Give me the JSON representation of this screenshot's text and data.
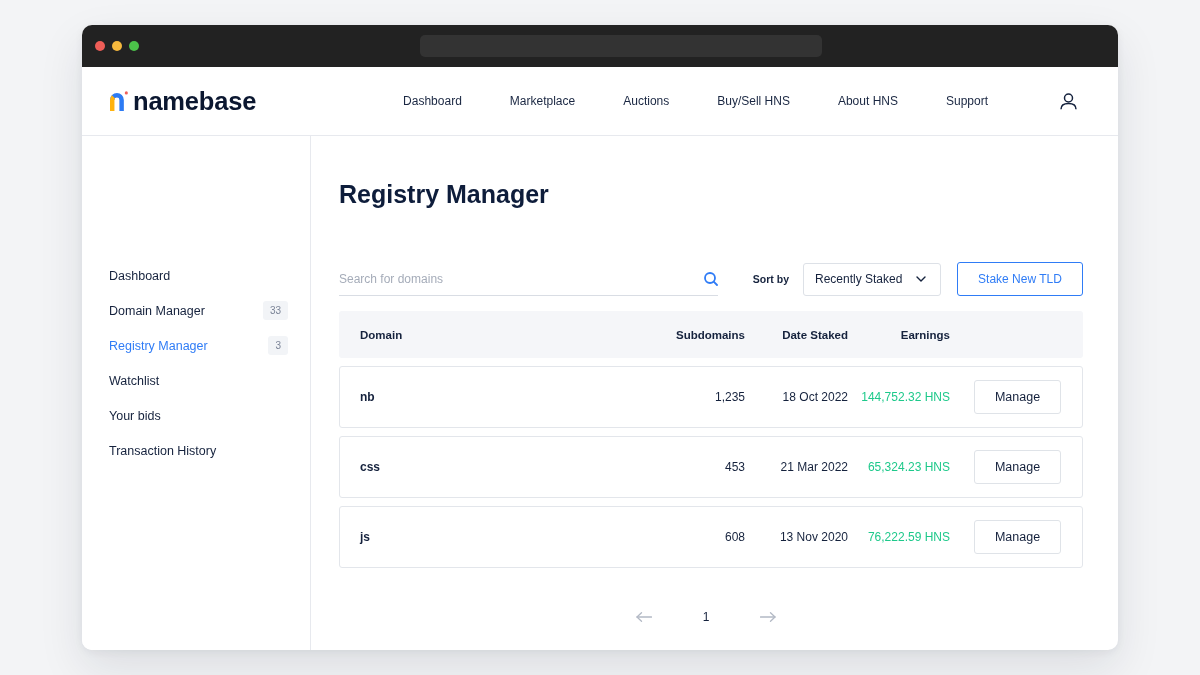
{
  "header": {
    "logo": "namebase",
    "nav": [
      "Dashboard",
      "Marketplace",
      "Auctions",
      "Buy/Sell HNS",
      "About HNS",
      "Support"
    ]
  },
  "sidebar": {
    "items": [
      {
        "label": "Dashboard",
        "selected": false
      },
      {
        "label": "Domain Manager",
        "badge": "33",
        "selected": false
      },
      {
        "label": "Registry Manager",
        "badge": "3",
        "selected": true
      },
      {
        "label": "Watchlist",
        "selected": false
      },
      {
        "label": "Your bids",
        "selected": false
      },
      {
        "label": "Transaction History",
        "selected": false
      }
    ]
  },
  "main": {
    "title": "Registry Manager",
    "search": {
      "placeholder": "Search for domains"
    },
    "sort": {
      "label": "Sort by",
      "value": "Recently Staked"
    },
    "action_button": "Stake New TLD"
  },
  "table": {
    "columns": [
      "Domain",
      "Subdomains",
      "Date Staked",
      "Earnings"
    ],
    "rows": [
      {
        "domain": "nb",
        "subdomains": "1,235",
        "date_staked": "18 Oct 2022",
        "earnings": "144,752.32 HNS",
        "action": "Manage"
      },
      {
        "domain": "css",
        "subdomains": "453",
        "date_staked": "21 Mar 2022",
        "earnings": "65,324.23 HNS",
        "action": "Manage"
      },
      {
        "domain": "js",
        "subdomains": "608",
        "date_staked": "13 Nov 2020",
        "earnings": "76,222.59 HNS",
        "action": "Manage"
      }
    ]
  },
  "pagination": {
    "previous": {
      "disabled": true
    },
    "pages": [
      "1"
    ],
    "next": {
      "disabled": true
    }
  }
}
